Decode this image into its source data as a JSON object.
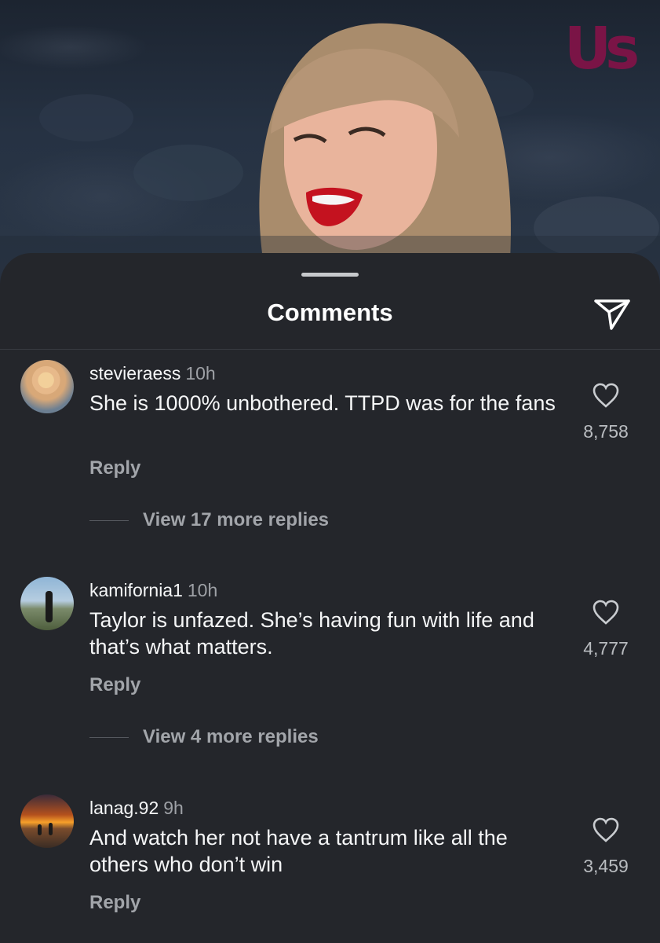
{
  "brand": {
    "logo_text": "Us",
    "color": "#7a1446"
  },
  "sheet": {
    "title": "Comments",
    "share_icon": "paper-plane-icon"
  },
  "comments": [
    {
      "username": "stevieraess",
      "time": "10h",
      "text": "She is 1000% unbothered. TTPD was for the fans",
      "likes": "8,758",
      "reply_label": "Reply",
      "view_replies": "View 17 more replies"
    },
    {
      "username": "kamifornia1",
      "time": "10h",
      "text": "Taylor is unfazed. She’s having fun with life and that’s what matters.",
      "likes": "4,777",
      "reply_label": "Reply",
      "view_replies": "View 4 more replies"
    },
    {
      "username": "lanag.92",
      "time": "9h",
      "text": "And watch her not have a tantrum like all the others who don’t win",
      "likes": "3,459",
      "reply_label": "Reply"
    }
  ]
}
